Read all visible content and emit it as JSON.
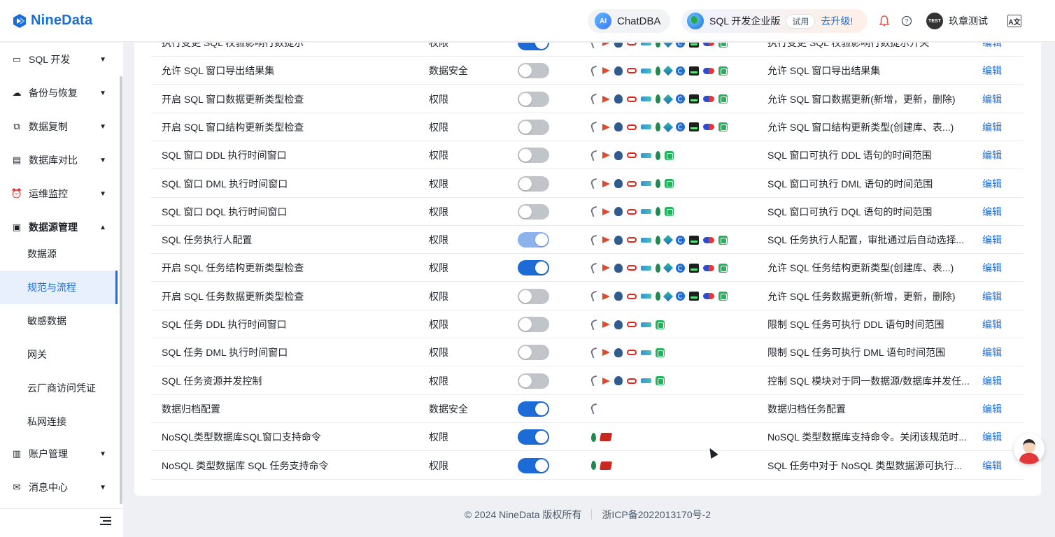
{
  "brand": {
    "name": "NineData"
  },
  "header": {
    "chatdba_label": "ChatDBA",
    "chatdba_badge": "AI",
    "edition_name": "SQL 开发企业版",
    "trial_label": "试用",
    "upgrade_label": "去升级!",
    "user_name": "玖章测试",
    "avatar_text": "TEST",
    "lang_text": "A文"
  },
  "sidebar": {
    "items": [
      {
        "label": "SQL 开发",
        "icon": "terminal-icon",
        "glyph": "▭",
        "expanded": false
      },
      {
        "label": "备份与恢复",
        "icon": "cloud-backup-icon",
        "glyph": "☁",
        "expanded": false
      },
      {
        "label": "数据复制",
        "icon": "copy-icon",
        "glyph": "⧉",
        "expanded": false
      },
      {
        "label": "数据库对比",
        "icon": "compare-icon",
        "glyph": "▤",
        "expanded": false
      },
      {
        "label": "运维监控",
        "icon": "alarm-icon",
        "glyph": "⏰",
        "expanded": false
      },
      {
        "label": "数据源管理",
        "icon": "datasource-icon",
        "glyph": "▣",
        "expanded": true
      }
    ],
    "sub_items": [
      {
        "label": "数据源",
        "active": false
      },
      {
        "label": "规范与流程",
        "active": true
      },
      {
        "label": "敏感数据",
        "active": false
      },
      {
        "label": "网关",
        "active": false
      },
      {
        "label": "云厂商访问凭证",
        "active": false
      },
      {
        "label": "私网连接",
        "active": false
      }
    ],
    "bottom_items": [
      {
        "label": "账户管理",
        "icon": "account-icon",
        "glyph": "▥"
      },
      {
        "label": "消息中心",
        "icon": "mail-icon",
        "glyph": "✉"
      }
    ]
  },
  "table": {
    "rows": [
      {
        "name": "执行变更 SQL 校验影响行数提示",
        "type": "权限",
        "toggle": "on",
        "icons": [
          "dolphin",
          "flag",
          "elephant",
          "oval",
          "cloud",
          "leaf",
          "diamond",
          "spiral",
          "dark",
          "capsule",
          "green"
        ],
        "desc": "执行变更 SQL 校验影响行数提示开关",
        "edit": "编辑"
      },
      {
        "name": "允许 SQL 窗口导出结果集",
        "type": "数据安全",
        "toggle": "off",
        "icons": [
          "dolphin",
          "flag",
          "elephant",
          "oval",
          "cloud",
          "leaf",
          "diamond",
          "spiral",
          "dark",
          "capsule",
          "green"
        ],
        "desc": "允许 SQL 窗口导出结果集",
        "edit": "编辑"
      },
      {
        "name": "开启 SQL 窗口数据更新类型检查",
        "type": "权限",
        "toggle": "off",
        "icons": [
          "dolphin",
          "flag",
          "elephant",
          "oval",
          "cloud",
          "leaf",
          "diamond",
          "spiral",
          "dark",
          "capsule",
          "green"
        ],
        "desc": "允许 SQL 窗口数据更新(新增，更新，删除)",
        "edit": "编辑"
      },
      {
        "name": "开启 SQL 窗口结构更新类型检查",
        "type": "权限",
        "toggle": "off",
        "icons": [
          "dolphin",
          "flag",
          "elephant",
          "oval",
          "cloud",
          "leaf",
          "diamond",
          "spiral",
          "dark",
          "capsule",
          "green"
        ],
        "desc": "允许 SQL 窗口结构更新类型(创建库、表...)",
        "edit": "编辑"
      },
      {
        "name": "SQL 窗口 DDL 执行时间窗口",
        "type": "权限",
        "toggle": "off",
        "icons": [
          "dolphin",
          "flag",
          "elephant",
          "oval",
          "cloud",
          "leaf",
          "green"
        ],
        "desc": "SQL 窗口可执行 DDL 语句的时间范围",
        "edit": "编辑"
      },
      {
        "name": "SQL 窗口 DML 执行时间窗口",
        "type": "权限",
        "toggle": "off",
        "icons": [
          "dolphin",
          "flag",
          "elephant",
          "oval",
          "cloud",
          "leaf",
          "green"
        ],
        "desc": "SQL 窗口可执行 DML 语句的时间范围",
        "edit": "编辑"
      },
      {
        "name": "SQL 窗口 DQL 执行时间窗口",
        "type": "权限",
        "toggle": "off",
        "icons": [
          "dolphin",
          "flag",
          "elephant",
          "oval",
          "cloud",
          "leaf",
          "green"
        ],
        "desc": "SQL 窗口可执行 DQL 语句的时间范围",
        "edit": "编辑"
      },
      {
        "name": "SQL 任务执行人配置",
        "type": "权限",
        "toggle": "dim",
        "icons": [
          "dolphin",
          "flag",
          "elephant",
          "oval",
          "cloud",
          "leaf",
          "diamond",
          "spiral",
          "dark",
          "capsule",
          "green"
        ],
        "desc": "SQL 任务执行人配置，审批通过后自动选择...",
        "edit": "编辑"
      },
      {
        "name": "开启 SQL 任务结构更新类型检查",
        "type": "权限",
        "toggle": "on",
        "icons": [
          "dolphin",
          "flag",
          "elephant",
          "oval",
          "cloud",
          "leaf",
          "diamond",
          "spiral",
          "dark",
          "capsule",
          "green"
        ],
        "desc": "允许 SQL 任务结构更新类型(创建库、表...)",
        "edit": "编辑"
      },
      {
        "name": "开启 SQL 任务数据更新类型检查",
        "type": "权限",
        "toggle": "off",
        "icons": [
          "dolphin",
          "flag",
          "elephant",
          "oval",
          "cloud",
          "leaf",
          "diamond",
          "spiral",
          "dark",
          "capsule",
          "green"
        ],
        "desc": "允许 SQL 任务数据更新(新增，更新，删除)",
        "edit": "编辑"
      },
      {
        "name": "SQL 任务 DDL 执行时间窗口",
        "type": "权限",
        "toggle": "off",
        "icons": [
          "dolphin",
          "flag",
          "elephant",
          "oval",
          "cloud",
          "green"
        ],
        "desc": "限制 SQL 任务可执行 DDL 语句时间范围",
        "edit": "编辑"
      },
      {
        "name": "SQL 任务 DML 执行时间窗口",
        "type": "权限",
        "toggle": "off",
        "icons": [
          "dolphin",
          "flag",
          "elephant",
          "oval",
          "cloud",
          "green"
        ],
        "desc": "限制 SQL 任务可执行 DML 语句时间范围",
        "edit": "编辑"
      },
      {
        "name": "SQL 任务资源并发控制",
        "type": "权限",
        "toggle": "off",
        "icons": [
          "dolphin",
          "flag",
          "elephant",
          "oval",
          "cloud",
          "green"
        ],
        "desc": "控制 SQL 模块对于同一数据源/数据库并发任...",
        "edit": "编辑"
      },
      {
        "name": "数据归档配置",
        "type": "数据安全",
        "toggle": "on",
        "icons": [
          "dolphin"
        ],
        "desc": "数据归档任务配置",
        "edit": "编辑"
      },
      {
        "name": "NoSQL类型数据库SQL窗口支持命令",
        "type": "权限",
        "toggle": "on",
        "icons": [
          "leaf",
          "redis"
        ],
        "desc": "NoSQL 类型数据库支持命令。关闭该规范时...",
        "edit": "编辑"
      },
      {
        "name": "NoSQL 类型数据库 SQL 任务支持命令",
        "type": "权限",
        "toggle": "on",
        "icons": [
          "leaf",
          "redis"
        ],
        "desc": "SQL 任务中对于 NoSQL 类型数据源可执行...",
        "edit": "编辑"
      }
    ]
  },
  "footer": {
    "copyright": "© 2024 NineData 版权所有",
    "icp": "浙ICP备2022013170号-2"
  }
}
